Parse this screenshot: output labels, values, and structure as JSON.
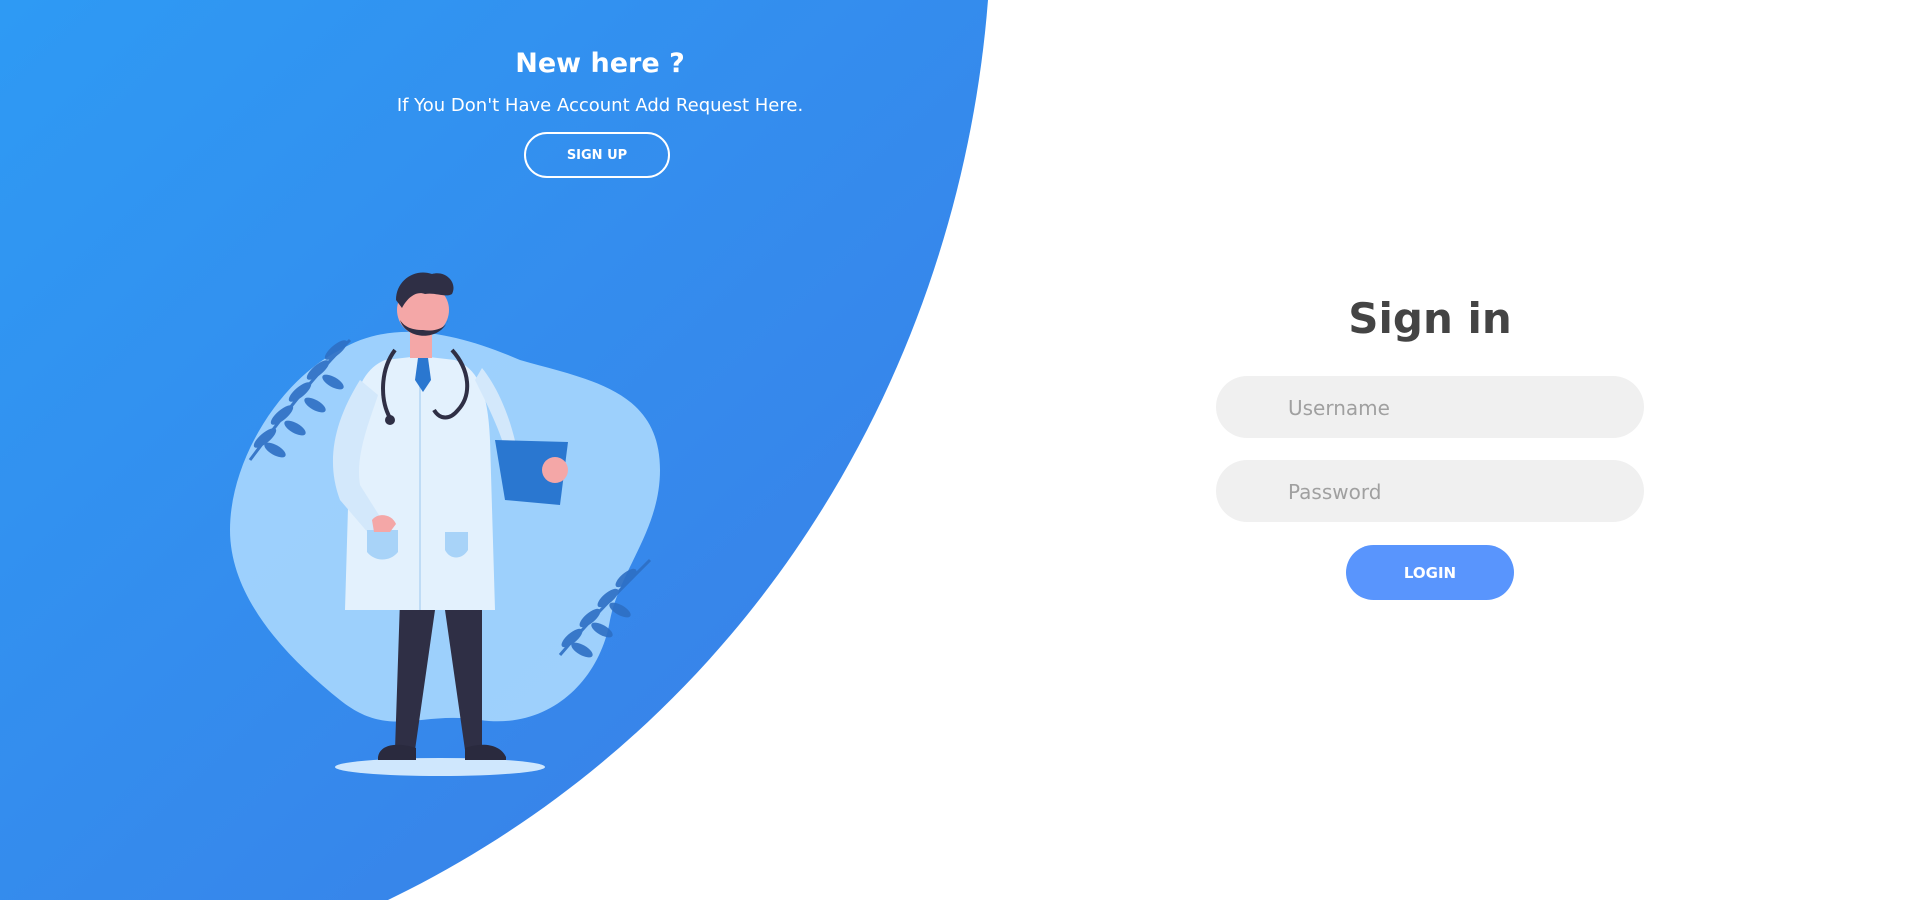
{
  "left_panel": {
    "title": "New here ?",
    "text": "If You Don't Have Account Add Request Here.",
    "signup_label": "SIGN UP"
  },
  "form": {
    "title": "Sign in",
    "username_placeholder": "Username",
    "password_placeholder": "Password",
    "login_label": "LOGIN"
  },
  "colors": {
    "gradient_start": "#2e9af4",
    "gradient_end": "#3b80e8",
    "button_accent": "#5995fd",
    "input_bg": "#f0f0f0",
    "title_text": "#444444"
  },
  "illustration": "doctor-illustration"
}
